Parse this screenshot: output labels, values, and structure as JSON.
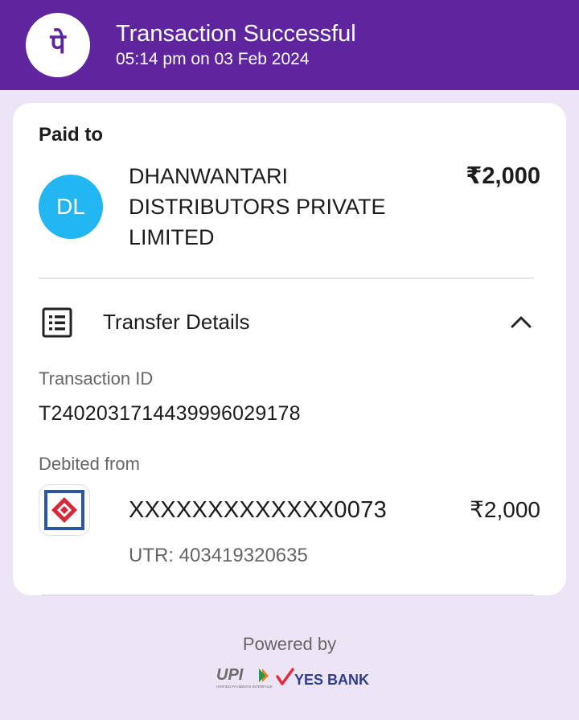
{
  "header": {
    "logo_glyph": "पे",
    "title": "Transaction Successful",
    "timestamp": "05:14 pm on 03 Feb 2024",
    "background_color": "#5f259f"
  },
  "paid_to": {
    "label": "Paid to",
    "avatar_initials": "DL",
    "avatar_color": "#22b6f2",
    "payee_name": "DHANWANTARI DISTRIBUTORS PRIVATE LIMITED",
    "amount": "₹2,000"
  },
  "transfer_details": {
    "icon": "receipt-list-icon",
    "label": "Transfer Details",
    "toggle_icon": "chevron-up-icon",
    "transaction_id_label": "Transaction ID",
    "transaction_id": "T2402031714439996029178",
    "debited_from_label": "Debited from",
    "bank_icon": "bank-logo-icon",
    "account": "XXXXXXXXXXXXX0073",
    "amount": "₹2,000",
    "utr": "UTR: 403419320635"
  },
  "footer": {
    "powered_by": "Powered by",
    "upi_logo": "UPI",
    "upi_tagline": "UNIFIED PAYMENTS INTERFACE",
    "bank_name": "YES BANK"
  }
}
